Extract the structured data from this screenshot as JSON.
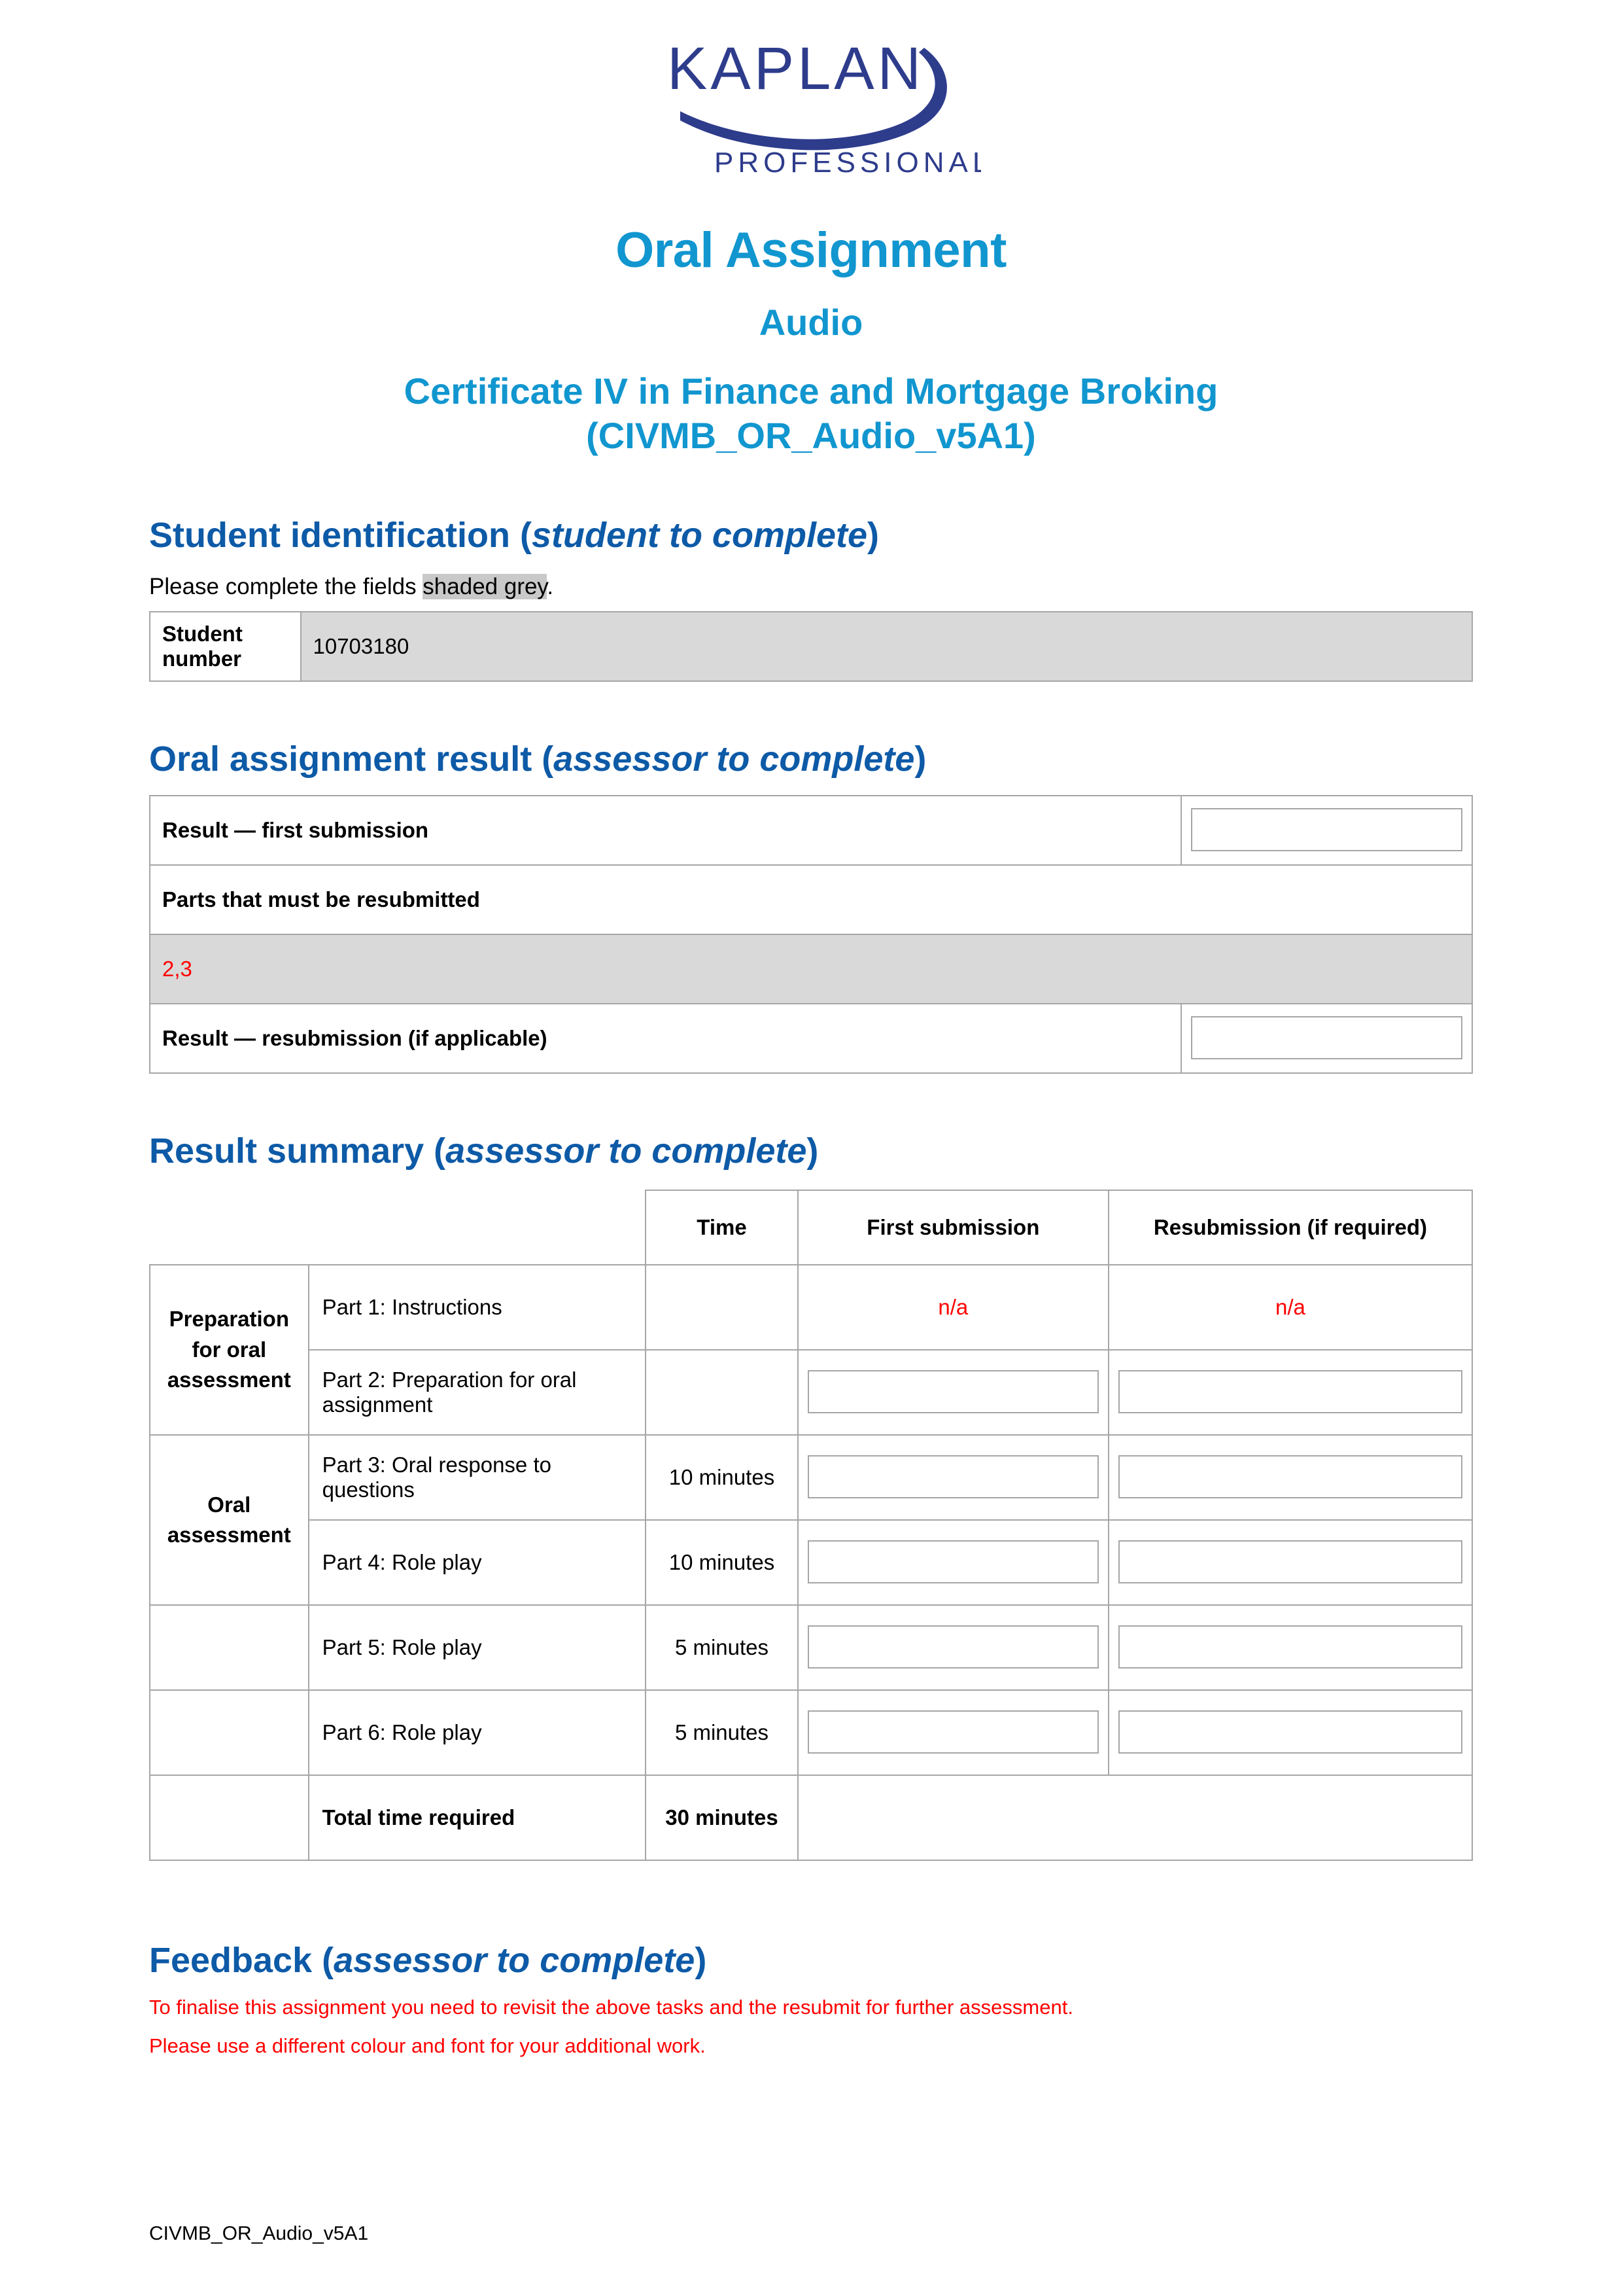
{
  "brand": {
    "logo_text": "KAPLAN",
    "logo_subtext": "PROFESSIONAL",
    "logo_color": "#2e3c8c",
    "title_color": "#1196cf",
    "heading_color": "#0d5aa7",
    "shade_color": "#d9d9d9",
    "red_color": "#ff0000"
  },
  "document": {
    "title": "Oral Assignment",
    "subtitle": "Audio",
    "course_line1": "Certificate IV in Finance and Mortgage Broking",
    "course_line2": "(CIVMB_OR_Audio_v5A1)"
  },
  "student_identification": {
    "heading_main": "Student identification (",
    "heading_italic": "student to complete",
    "heading_close": ")",
    "instruction_before": "Please complete the fields ",
    "instruction_shaded": "shaded grey",
    "instruction_after": ".",
    "label": "Student number",
    "value": "10703180"
  },
  "oral_assignment_result": {
    "heading_main": "Oral assignment result (",
    "heading_italic": "assessor to complete",
    "heading_close": ")",
    "rows": {
      "result_first": "Result — first submission",
      "parts_resubmitted": "Parts that must be resubmitted",
      "parts_value": "2,3",
      "result_resubmission": "Result — resubmission (if applicable)"
    }
  },
  "result_summary": {
    "heading_main": "Result summary (",
    "heading_italic": "assessor to complete",
    "heading_close": ")",
    "columns": {
      "blank1": "",
      "blank2": "",
      "time": "Time",
      "first_submission": "First submission",
      "resubmission": "Resubmission (if required)"
    },
    "group_labels": {
      "preparation": "Preparation for oral assessment",
      "oral": "Oral assessment"
    },
    "rows": [
      {
        "part": "Part 1: Instructions",
        "time": "",
        "first_submission": "n/a",
        "resubmission": "n/a",
        "first_is_box": false,
        "resub_is_box": false
      },
      {
        "part": "Part 2: Preparation for oral assignment",
        "time": "",
        "first_submission": "",
        "resubmission": "",
        "first_is_box": true,
        "resub_is_box": true
      },
      {
        "part": "Part 3: Oral response to questions",
        "time": "10 minutes",
        "first_submission": "",
        "resubmission": "",
        "first_is_box": true,
        "resub_is_box": true
      },
      {
        "part": "Part 4: Role play",
        "time": "10 minutes",
        "first_submission": "",
        "resubmission": "",
        "first_is_box": true,
        "resub_is_box": true
      },
      {
        "part": "Part 5: Role play",
        "time": "5 minutes",
        "first_submission": "",
        "resubmission": "",
        "first_is_box": true,
        "resub_is_box": true
      },
      {
        "part": "Part 6: Role play",
        "time": "5 minutes",
        "first_submission": "",
        "resubmission": "",
        "first_is_box": true,
        "resub_is_box": true
      }
    ],
    "total_row": {
      "label": "Total time required",
      "time": "30 minutes"
    }
  },
  "feedback": {
    "heading_main": "Feedback (",
    "heading_italic": "assessor to complete",
    "heading_close": ")",
    "line1": "To finalise this assignment you need to revisit the above tasks and the resubmit for further assessment.",
    "line2": "Please use a different colour and font for your additional work."
  },
  "footer": {
    "text": "CIVMB_OR_Audio_v5A1"
  }
}
